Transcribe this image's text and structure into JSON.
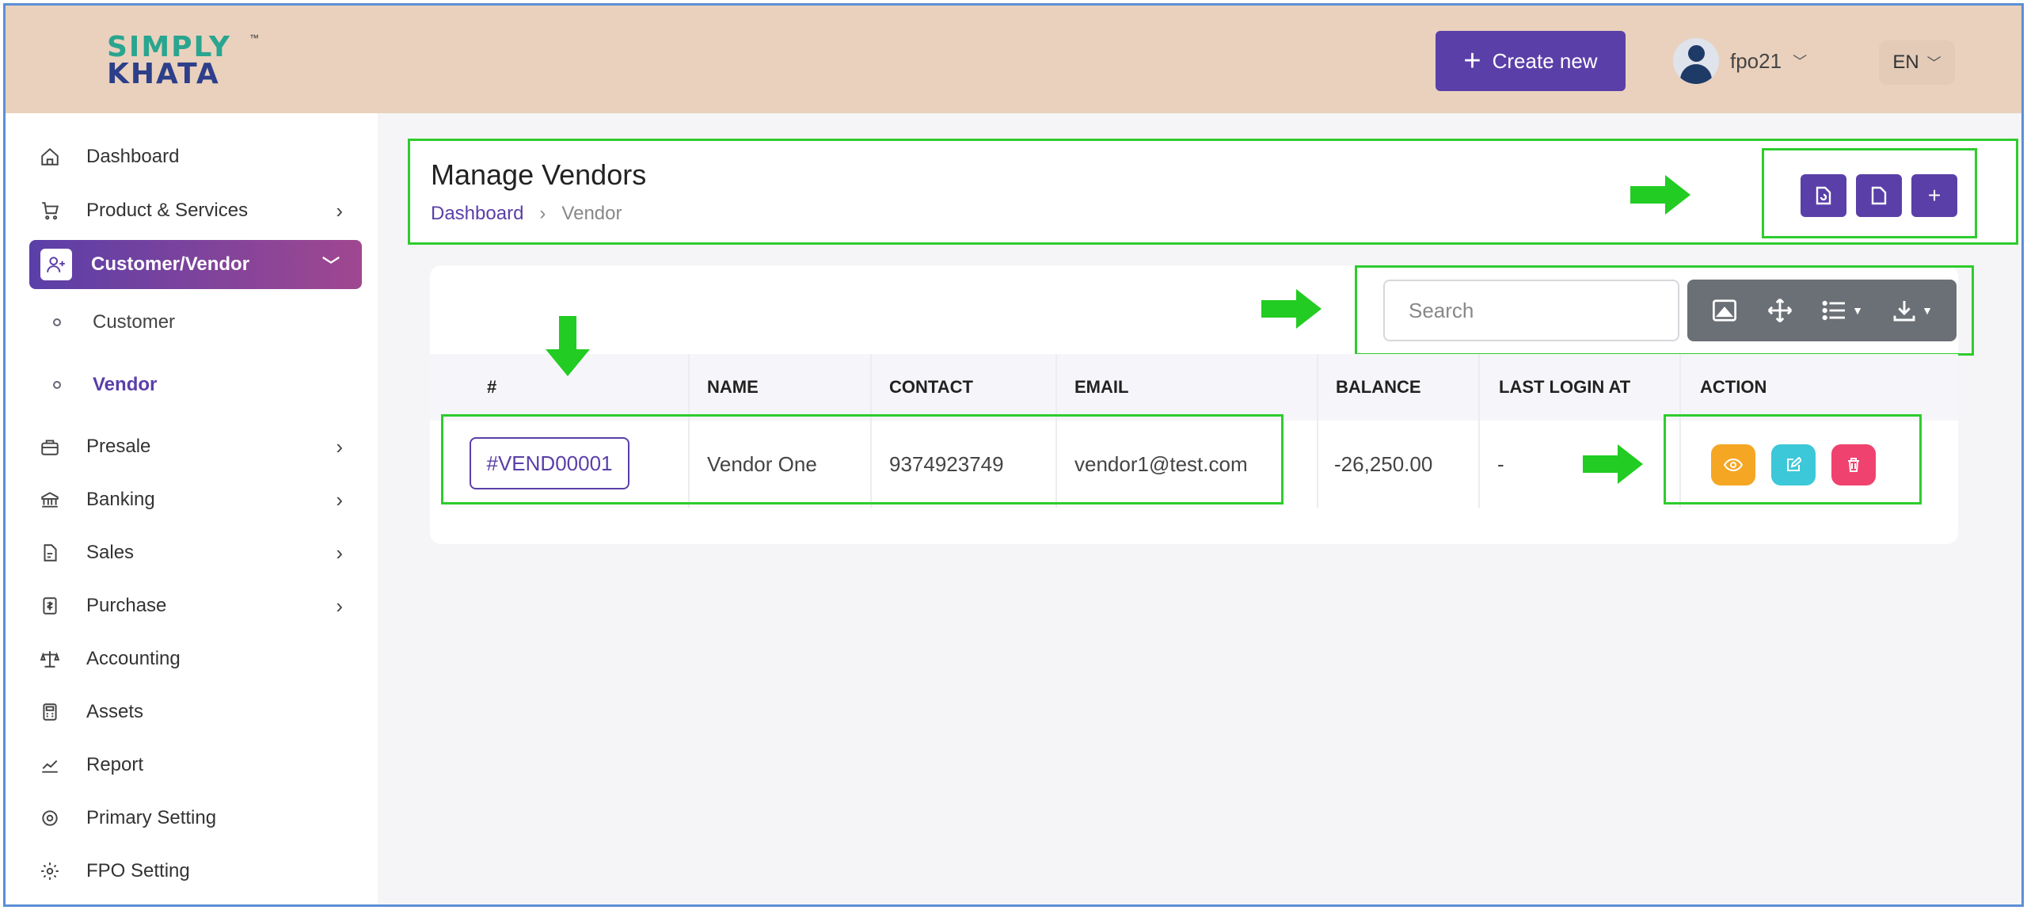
{
  "brand": {
    "line1": "SIMPLY",
    "line2": "KHATA",
    "tm": "™"
  },
  "header": {
    "create_label": "Create new",
    "user_name": "fpo21",
    "language": "EN"
  },
  "sidebar": {
    "items": [
      {
        "label": "Dashboard",
        "icon": "home-icon"
      },
      {
        "label": "Product & Services",
        "icon": "cart-icon"
      },
      {
        "label": "Customer/Vendor",
        "icon": "user-plus-icon"
      },
      {
        "label": "Customer"
      },
      {
        "label": "Vendor"
      },
      {
        "label": "Presale",
        "icon": "presale-icon"
      },
      {
        "label": "Banking",
        "icon": "bank-icon"
      },
      {
        "label": "Sales",
        "icon": "document-icon"
      },
      {
        "label": "Purchase",
        "icon": "receipt-icon"
      },
      {
        "label": "Accounting",
        "icon": "scale-icon"
      },
      {
        "label": "Assets",
        "icon": "calculator-icon"
      },
      {
        "label": "Report",
        "icon": "chart-icon"
      },
      {
        "label": "Primary Setting",
        "icon": "settings-icon"
      },
      {
        "label": "FPO Setting",
        "icon": "gear-icon"
      }
    ]
  },
  "page": {
    "title": "Manage Vendors",
    "breadcrumb": [
      "Dashboard",
      "Vendor"
    ]
  },
  "table": {
    "search_placeholder": "Search",
    "columns": [
      "#",
      "NAME",
      "CONTACT",
      "EMAIL",
      "BALANCE",
      "LAST LOGIN AT",
      "ACTION"
    ],
    "rows": [
      {
        "id": "#VEND00001",
        "name": "Vendor One",
        "contact": "9374923749",
        "email": "vendor1@test.com",
        "balance": "-26,250.00",
        "last_login": "-"
      }
    ]
  },
  "colors": {
    "primary": "#5a3fa8",
    "header_bg": "#ead1bd",
    "highlight": "#2ecc2e",
    "view": "#f5a623",
    "edit": "#3cc8d8",
    "delete": "#f0426e"
  }
}
